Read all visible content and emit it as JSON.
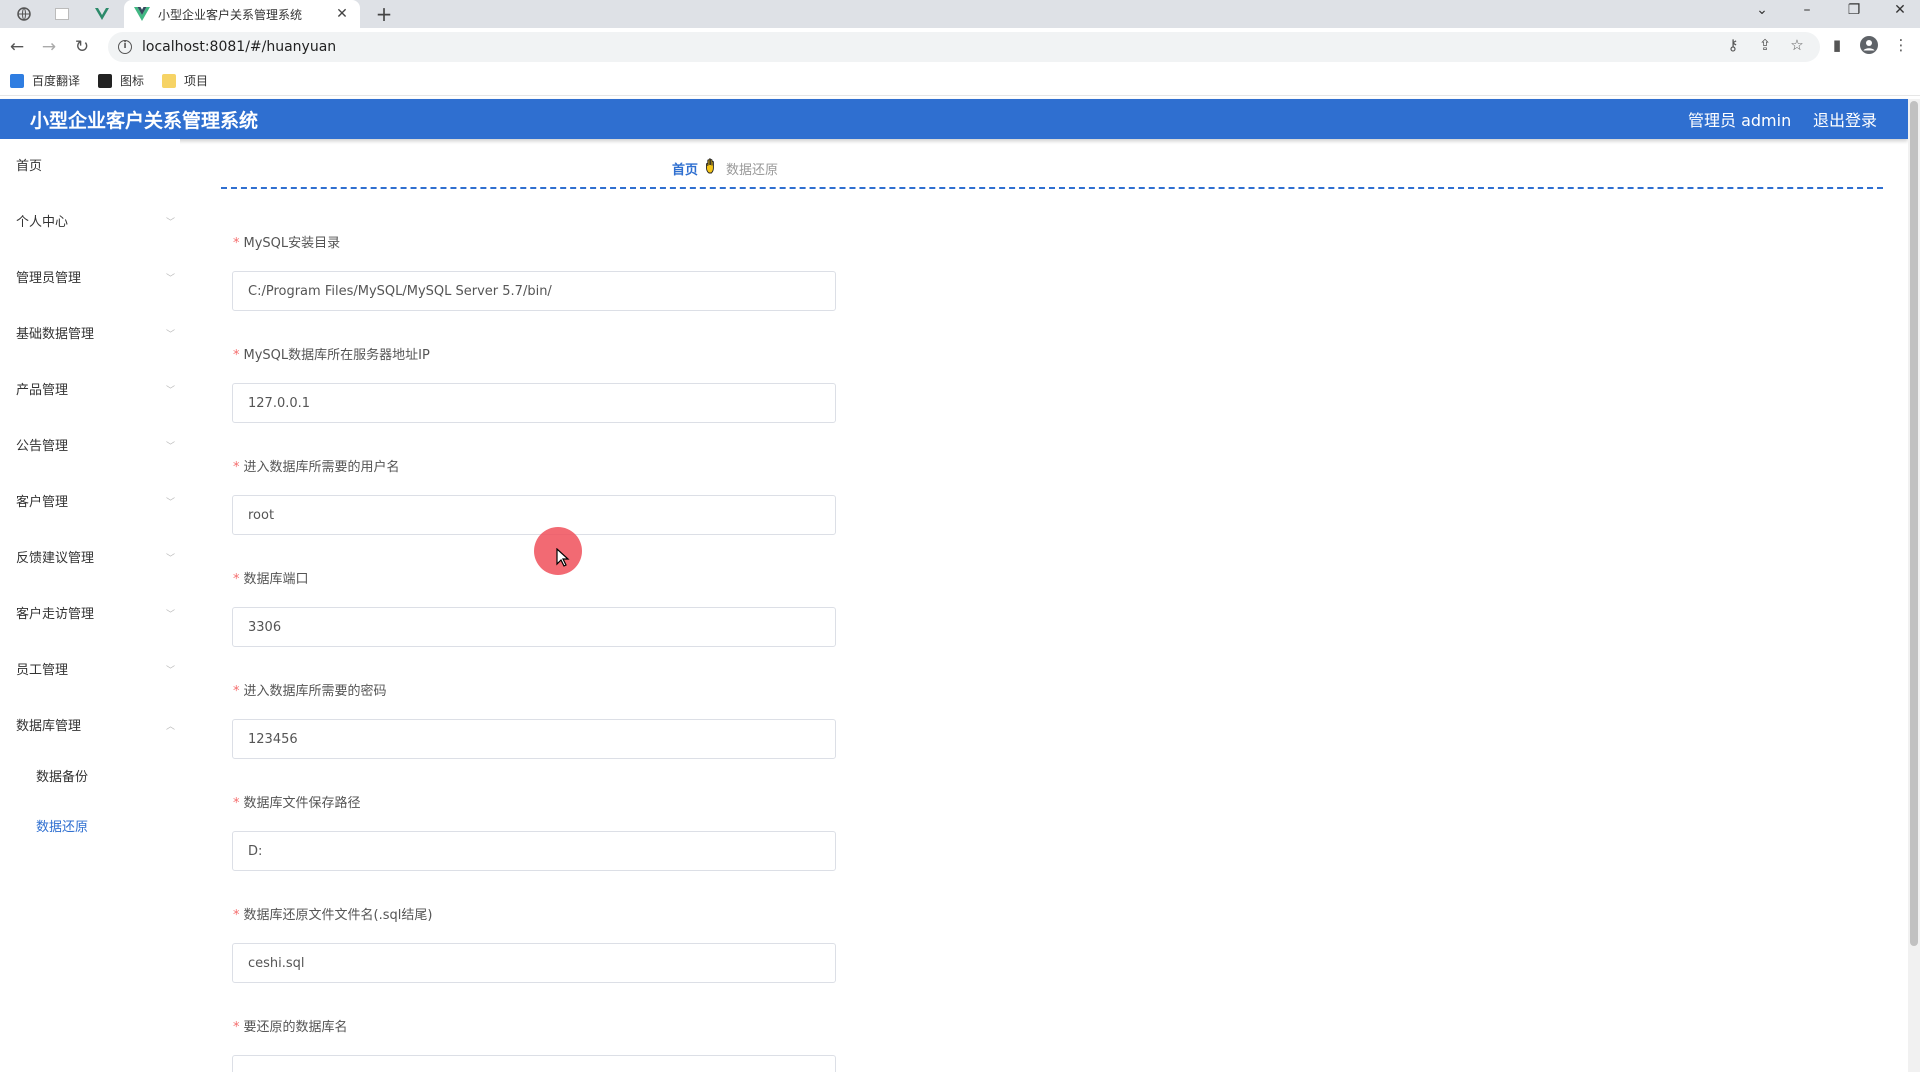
{
  "browser": {
    "tab_title": "小型企业客户关系管理系统",
    "url": "localhost:8081/#/huanyuan",
    "bookmarks": [
      "百度翻译",
      "图标",
      "项目"
    ]
  },
  "header": {
    "title": "小型企业客户关系管理系统",
    "user": "管理员 admin",
    "logout": "退出登录"
  },
  "sidebar": {
    "items": [
      {
        "label": "首页"
      },
      {
        "label": "个人中心"
      },
      {
        "label": "管理员管理"
      },
      {
        "label": "基础数据管理"
      },
      {
        "label": "产品管理"
      },
      {
        "label": "公告管理"
      },
      {
        "label": "客户管理"
      },
      {
        "label": "反馈建议管理"
      },
      {
        "label": "客户走访管理"
      },
      {
        "label": "员工管理"
      },
      {
        "label": "数据库管理"
      }
    ],
    "subitems": [
      {
        "label": "数据备份"
      },
      {
        "label": "数据还原"
      }
    ]
  },
  "breadcrumb": {
    "home": "首页",
    "current": "数据还原"
  },
  "form": {
    "required_mark": "*",
    "fields": [
      {
        "label": "MySQL安装目录",
        "value": "C:/Program Files/MySQL/MySQL Server 5.7/bin/"
      },
      {
        "label": "MySQL数据库所在服务器地址IP",
        "value": "127.0.0.1"
      },
      {
        "label": "进入数据库所需要的用户名",
        "value": "root"
      },
      {
        "label": "数据库端口",
        "value": "3306"
      },
      {
        "label": "进入数据库所需要的密码",
        "value": "123456"
      },
      {
        "label": "数据库文件保存路径",
        "value": "D:"
      },
      {
        "label": "数据库还原文件文件名(.sql结尾)",
        "value": "ceshi.sql"
      },
      {
        "label": "要还原的数据库名",
        "value": ""
      }
    ]
  },
  "colors": {
    "primary": "#2f6fd0",
    "required": "#f56c6c",
    "cursor_highlight": "#f0505a"
  }
}
